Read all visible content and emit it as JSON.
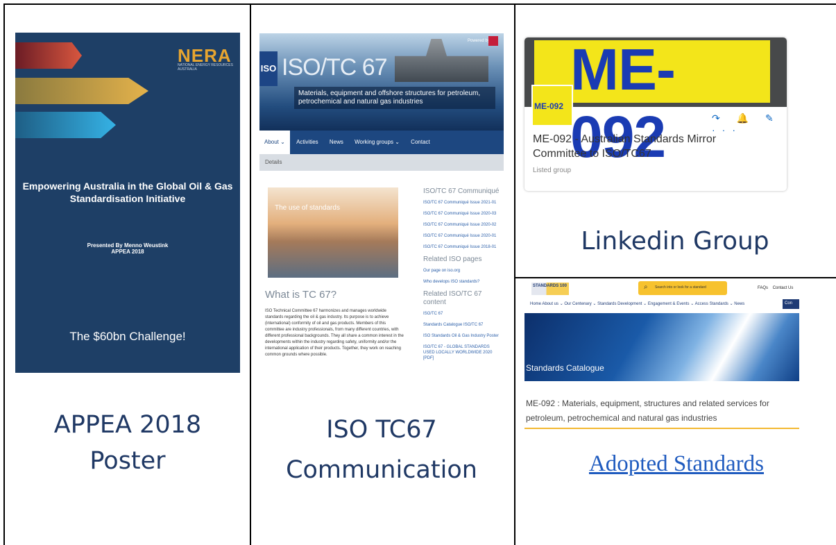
{
  "poster": {
    "nera_logo": "NERA",
    "nera_sub": "NATIONAL ENERGY RESOURCES AUSTRALIA",
    "title": "Empowering Australia in the Global Oil & Gas Standardisation Initiative",
    "presented": "Presented By Menno Weustink",
    "event": "APPEA 2018",
    "challenge": "The $60bn Challenge!",
    "caption_line1": "APPEA 2018",
    "caption_line2": "Poster"
  },
  "iso": {
    "badge": "ISO",
    "title": "ISO/TC 67",
    "powered_by": "Powered by",
    "description": "Materials, equipment and offshore structures for petroleum, petrochemical and natural gas industries",
    "nav": [
      "About ⌄",
      "Activities",
      "News",
      "Working groups ⌄",
      "Contact"
    ],
    "subnav": "Details",
    "image_text": "The use of standards",
    "what_heading": "What is TC 67?",
    "what_body": "ISO Technical Committee 67 harmonizes and manages worldwide standards regarding the oil & gas industry. Its purpose is to achieve (international) conformity of oil and gas products. Members of this committee are industry professionals, from many different countries, with different professional backgrounds. They all share a common interest in the developments within the industry regarding safety, uniformity and/or the international application of their products. Together, they work on reaching common grounds where possible.",
    "communique_heading": "ISO/TC 67 Communiqué",
    "communique_links": [
      "ISO/TC 67 Communiqué Issue 2021-01",
      "ISO/TC 67 Communiqué Issue 2020-03",
      "ISO/TC 67 Communiqué Issue 2020-02",
      "ISO/TC 67 Communiqué Issue 2020-01",
      "ISO/TC 67 Communiqué Issue 2018-01"
    ],
    "related_heading": "Related ISO pages",
    "related_links": [
      "Our page on iso.org",
      "Who develops ISO standards?"
    ],
    "content_heading": "Related ISO/TC 67 content",
    "content_links": [
      "ISO/TC 67",
      "Standards Catalogue ISO/TC 67",
      "ISO Standards Oil & Gas Industry Poster",
      "ISO/TC 67 - GLOBAL STANDARDS USED LOCALLY WORLDWIDE 2020 [PDF]"
    ],
    "caption_line1": "ISO TC67",
    "caption_line2": "Communication"
  },
  "linkedin": {
    "banner_text": "ME-092",
    "logo_text": "ME-092",
    "action_icons": "↷ 🔔 ✎ ···",
    "group_name": "ME-092 - Australian Standards Mirror Committee to ISO/TC67",
    "listed": "Listed group",
    "caption": "Linkedin Group"
  },
  "standards": {
    "logo_text": "STANDARDS 100",
    "search_placeholder": "Search into or look for a standard",
    "faqs": "FAQs",
    "contact": "Contact Us",
    "nav": "Home   About us ⌄   Our Centenary ⌄   Standards Development ⌄   Engagement & Events ⌄   Access Standards ⌄   News",
    "connect": "Con",
    "hero_text": "Standards Catalogue",
    "description": "ME-092 : Materials, equipment, structures and related services for petroleum, petrochemical and natural gas industries",
    "caption_link": "Adopted Standards"
  }
}
